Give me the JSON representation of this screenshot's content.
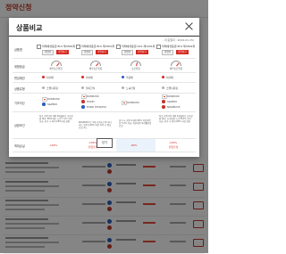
{
  "background": {
    "page_title": "정약신청"
  },
  "modal": {
    "title": "상품비교",
    "date": "(기준일자 : 2024.01.15)",
    "confirm_label": "닫기",
    "row_headers": [
      "상품명",
      "위험등급",
      "편입채권",
      "상품유형",
      "기초자산",
      "상환조건",
      "최대손실"
    ],
    "products": [
      {
        "name": "미래에셋증권 ELS 제3300회",
        "buttons": [
          "설명서",
          "가입하기"
        ],
        "risk": "매우높은위험",
        "bond": "회사채",
        "type": "스텝다운형",
        "assets": [
          "KOSPI200",
          "S&P500"
        ],
        "condition": "최초 기준가격 대비 6개월마다 조기상환 평가, 85%이상 시 연 7.1% 수익 지급, 만기 시 최저 65%이상 상환",
        "loss": "-100%",
        "loss_extra": ""
      },
      {
        "name": "미래에셋증권 ELS 제3301회",
        "buttons": [
          "설명서",
          "가입하기"
        ],
        "risk": "매우높은위험",
        "bond": "회사채",
        "type": "월지급식",
        "assets": [
          "KOSPI200",
          "HSCEI",
          "EURO STOXX50"
        ],
        "condition": "KOSPI200 등 3개 기초자산 중 하나라도 기준가 60% 미만 하락 시 원금손실 가능",
        "loss": "-100%",
        "loss_extra": "원금손실"
      },
      {
        "name": "미래에셋증권 DLS 제1201회",
        "buttons": [
          "설명서",
          "가입하기"
        ],
        "risk": "높은위험",
        "bond": "국공채",
        "type": "노녹인형",
        "assets": [
          "KOSPI200"
        ],
        "condition": "만기 시 기준가 대비 80% 이상이면 연 5.2% 지급, 미만이면 하락률만큼 손실",
        "loss": "-80%",
        "loss_extra": ""
      },
      {
        "name": "미래에셋증권 ELS 제3302회",
        "buttons": [
          "설명서",
          "가입하기"
        ],
        "risk": "매우높은위험",
        "bond": "회사채",
        "type": "스텝다운형",
        "assets": [
          "KOSPI200",
          "S&P500",
          "NIKKEI225"
        ],
        "condition": "최초 기준가격 대비 4개월마다 조기상환 평가, 조기상환 시 연 8.0% 수익 지급, 만기 시 최저 60% 이상 상환",
        "loss": "-100%",
        "loss_extra": "원금손실"
      }
    ]
  }
}
